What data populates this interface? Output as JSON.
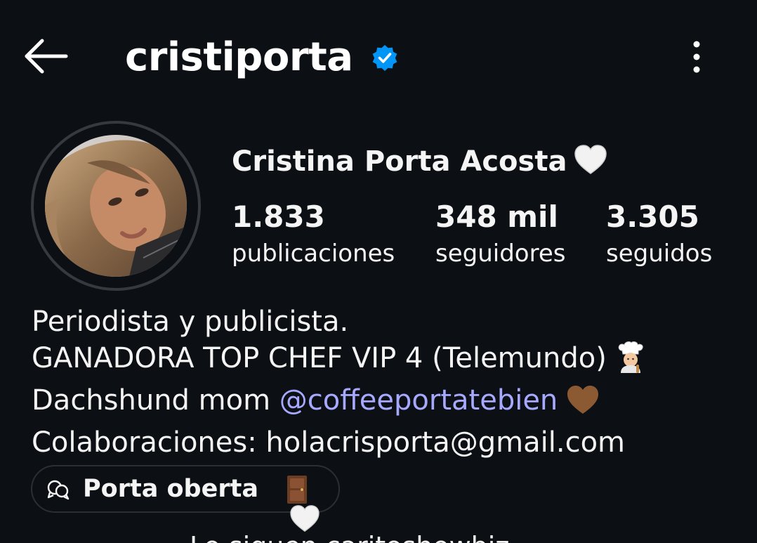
{
  "header": {
    "username": "cristiporta",
    "verified": true,
    "back_icon": "arrow-left-icon",
    "more_icon": "more-vertical-icon"
  },
  "profile": {
    "full_name": "Cristina Porta Acosta",
    "name_emoji": "white-heart",
    "stats": {
      "posts_value": "1.833",
      "posts_label": "publicaciones",
      "followers_value": "348 mil",
      "followers_label": "seguidores",
      "following_value": "3.305",
      "following_label": "seguidos"
    }
  },
  "bio": {
    "line1": "Periodista y publicista.",
    "line2": "GANADORA TOP CHEF VIP 4 (Telemundo)",
    "line2_emoji": "cook-emoji",
    "line3_prefix": "Dachshund mom ",
    "line3_mention": "@coffeeportatebien",
    "line3_emoji": "brown-heart",
    "line4": "Colaboraciones: holacrisporta@gmail.com"
  },
  "channel": {
    "label": "Porta oberta",
    "icon": "broadcast-chat-icon",
    "emojis": [
      "door-emoji",
      "white-heart"
    ]
  },
  "followed_by": {
    "text": "Lo siguen caritoshowbiz"
  },
  "colors": {
    "background": "#0c1014",
    "text": "#f5f5f5",
    "mention": "#a7a9ff",
    "verified_badge": "#0095f6",
    "avatar_ring": "#363a40",
    "pill_border": "#2b2f35"
  }
}
